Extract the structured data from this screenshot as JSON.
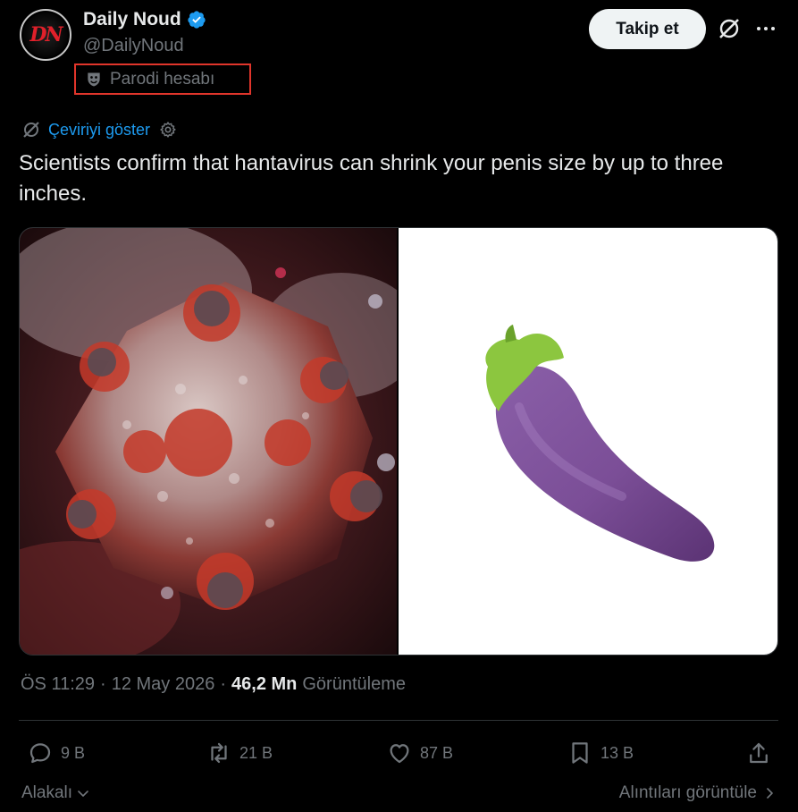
{
  "author": {
    "display_name": "Daily Noud",
    "handle": "@DailyNoud",
    "avatar_initials": "DN",
    "verified": true,
    "parody_label": "Parodi hesabı"
  },
  "header": {
    "follow_label": "Takip et",
    "grok_icon": "grok-icon",
    "more_icon": "more-dots-icon"
  },
  "translate": {
    "label": "Çeviriyi göster",
    "icon": "translate-icon",
    "settings_icon": "gear-icon"
  },
  "tweet": {
    "text": "Scientists confirm that hantavirus can shrink your penis size by up to three inches.",
    "media": [
      {
        "name": "virus-image",
        "description_icon": "virus-illustration"
      },
      {
        "name": "eggplant-image",
        "description_icon": "eggplant-emoji"
      }
    ]
  },
  "meta": {
    "time": "ÖS 11:29",
    "date": "12 May 2026",
    "separator": "·",
    "views_count": "46,2 Mn",
    "views_label": "Görüntüleme"
  },
  "actions": {
    "replies": "9 B",
    "reposts": "21 B",
    "likes": "87 B",
    "bookmarks": "13 B"
  },
  "footer": {
    "related_label": "Alakalı",
    "quotes_label": "Alıntıları görüntüle"
  },
  "colors": {
    "background": "#000000",
    "text": "#e7e9ea",
    "muted": "#71767b",
    "link": "#1d9bf0",
    "verified": "#1d9bf0",
    "highlight_border": "#e0352b",
    "avatar_red": "#e0202a"
  }
}
